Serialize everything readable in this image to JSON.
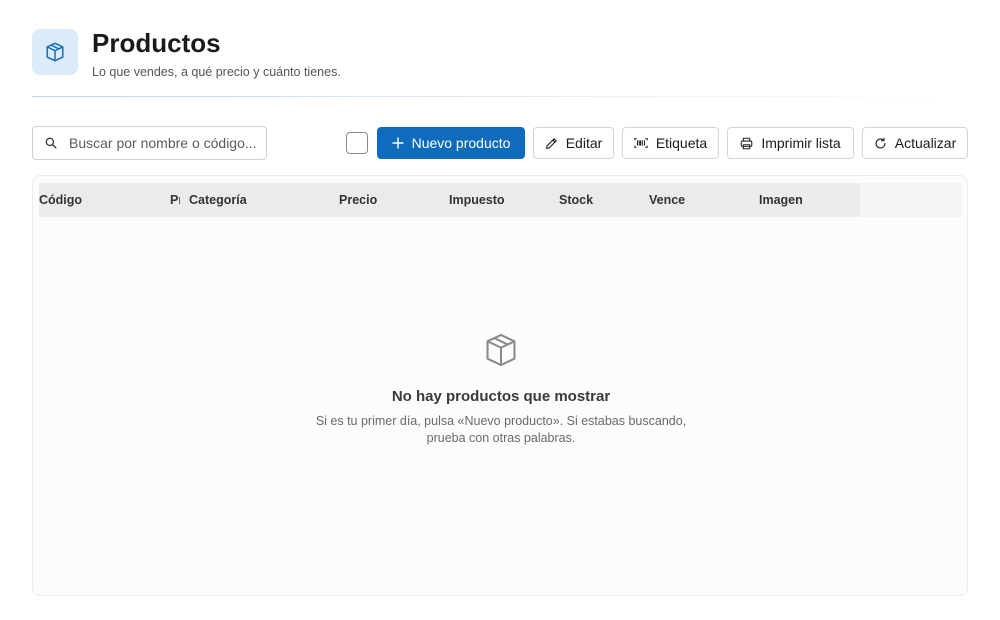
{
  "header": {
    "icon": "box-icon",
    "title": "Productos",
    "subtitle": "Lo que vendes, a qué precio y cuánto tienes."
  },
  "toolbar": {
    "search_placeholder": "Buscar por nombre o código...",
    "new_label": "Nuevo producto",
    "edit_label": "Editar",
    "label_label": "Etiqueta",
    "print_label": "Imprimir lista",
    "refresh_label": "Actualizar"
  },
  "table": {
    "columns": [
      "Código",
      "Producto",
      "Categoría",
      "Precio",
      "Impuesto",
      "Stock",
      "Vence",
      "Imagen"
    ],
    "rows": []
  },
  "empty_state": {
    "icon": "box-icon",
    "title": "No hay productos que mostrar",
    "description": "Si es tu primer día, pulsa «Nuevo producto». Si estabas buscando, prueba con otras palabras."
  },
  "colors": {
    "accent": "#0f6cbd",
    "header_icon_bg": "#dcebf8"
  }
}
